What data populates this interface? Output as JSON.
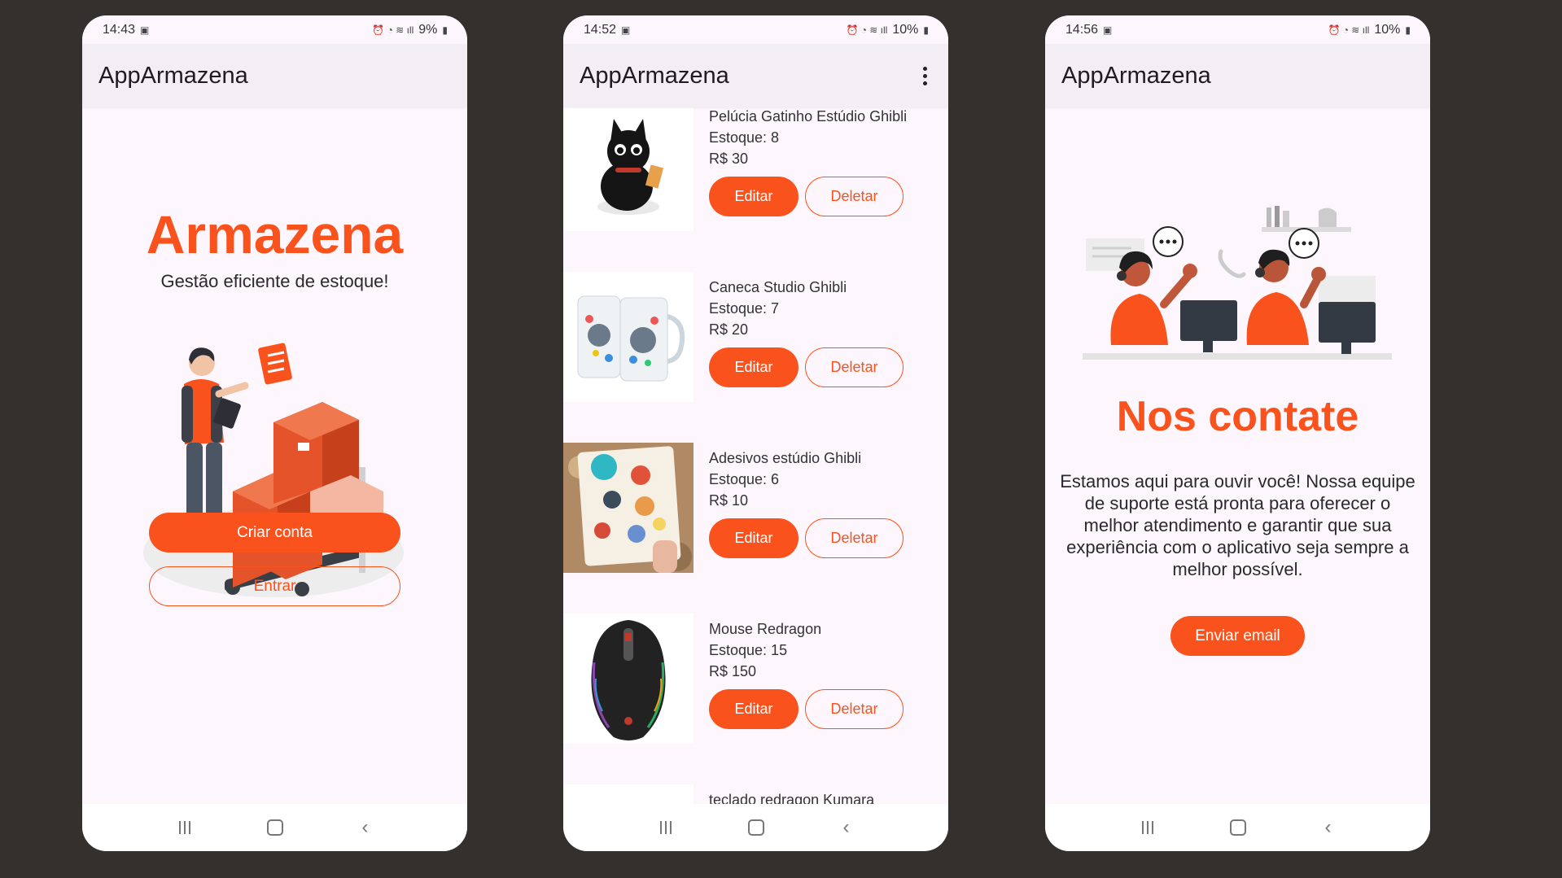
{
  "colors": {
    "accent": "#fa521c",
    "background": "#34302d",
    "screen": "#fdf7fd",
    "appbar": "#f3eef4"
  },
  "screens": [
    {
      "status": {
        "time": "14:43",
        "battery": "9%"
      },
      "app_title": "AppArmazena",
      "brand": "Armazena",
      "tagline": "Gestão eficiente de estoque!",
      "create_account_label": "Criar conta",
      "login_label": "Entrar"
    },
    {
      "status": {
        "time": "14:52",
        "battery": "10%"
      },
      "app_title": "AppArmazena",
      "products": [
        {
          "name": "Pelúcia Gatinho Estúdio Ghibli",
          "stock": "Estoque: 8",
          "price": "R$ 30",
          "edit": "Editar",
          "delete": "Deletar"
        },
        {
          "name": "Caneca Studio Ghibli",
          "stock": "Estoque: 7",
          "price": "R$ 20",
          "edit": "Editar",
          "delete": "Deletar"
        },
        {
          "name": "Adesivos estúdio Ghibli",
          "stock": "Estoque: 6",
          "price": "R$ 10",
          "edit": "Editar",
          "delete": "Deletar"
        },
        {
          "name": "Mouse Redragon",
          "stock": "Estoque: 15",
          "price": "R$ 150",
          "edit": "Editar",
          "delete": "Deletar"
        },
        {
          "name": "teclado redragon Kumara"
        }
      ]
    },
    {
      "status": {
        "time": "14:56",
        "battery": "10%"
      },
      "app_title": "AppArmazena",
      "title": "Nos contate",
      "text": "Estamos aqui para ouvir você! Nossa equipe de suporte está pronta para oferecer o melhor atendimento e garantir que sua experiência com o aplicativo seja sempre a melhor possível.",
      "email_label": "Enviar email"
    }
  ]
}
